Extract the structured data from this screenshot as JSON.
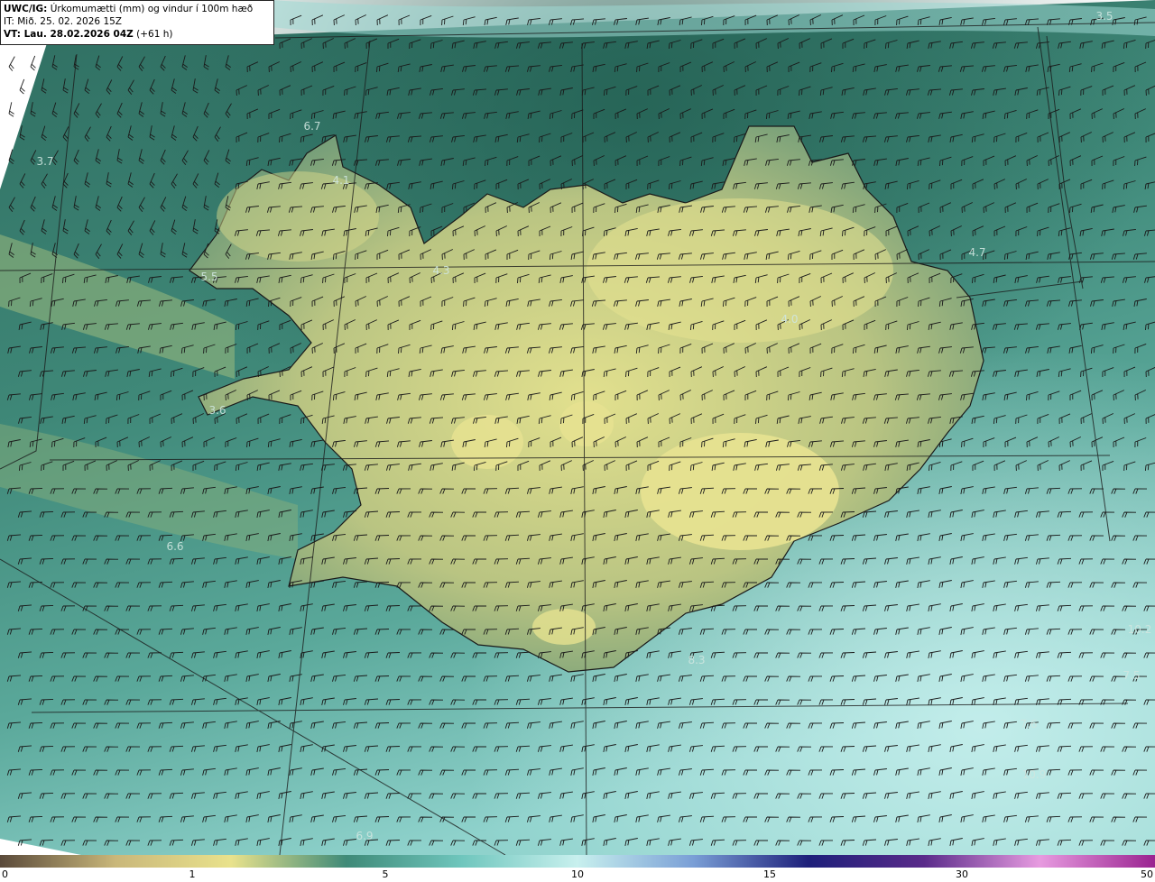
{
  "header": {
    "model": "UWC/IG:",
    "title": " Úrkomumætti (mm) og vindur í 100m hæð",
    "issue_time": "IT: Mið. 25. 02. 2026 15Z",
    "valid_label": "VT: Lau. 28.02.2026 04Z",
    "lead": " (+61 h)"
  },
  "map": {
    "colors": {
      "ocean_dark": "#2f6e61",
      "ocean_mid": "#4a9a8c",
      "ocean_light": "#8fd2cc",
      "land_low": "#6e9a78",
      "land_high": "#e2e08e"
    },
    "value_labels": [
      {
        "text": "3.5"
      },
      {
        "text": "6.7"
      },
      {
        "text": "3.7"
      },
      {
        "text": "4.1"
      },
      {
        "text": "5.5"
      },
      {
        "text": "4.3"
      },
      {
        "text": "4.7"
      },
      {
        "text": "4.0"
      },
      {
        "text": "3.6"
      },
      {
        "text": "6.6"
      },
      {
        "text": "8.3"
      },
      {
        "text": "10.2"
      },
      {
        "text": "7.6"
      },
      {
        "text": "10.9"
      },
      {
        "text": "6.9"
      },
      {
        "text": "7.5"
      }
    ]
  },
  "colorbar": {
    "ticks": [
      "0",
      "1",
      "5",
      "10",
      "15",
      "30",
      "50"
    ],
    "stops": [
      "#5a4a3a",
      "#c9b77a",
      "#e9e28c",
      "#3f8a78",
      "#6fc6bd",
      "#c8f0ee",
      "#7a9fd6",
      "#1d1f7a",
      "#5a2b8a",
      "#e79be0",
      "#9a2390"
    ]
  }
}
